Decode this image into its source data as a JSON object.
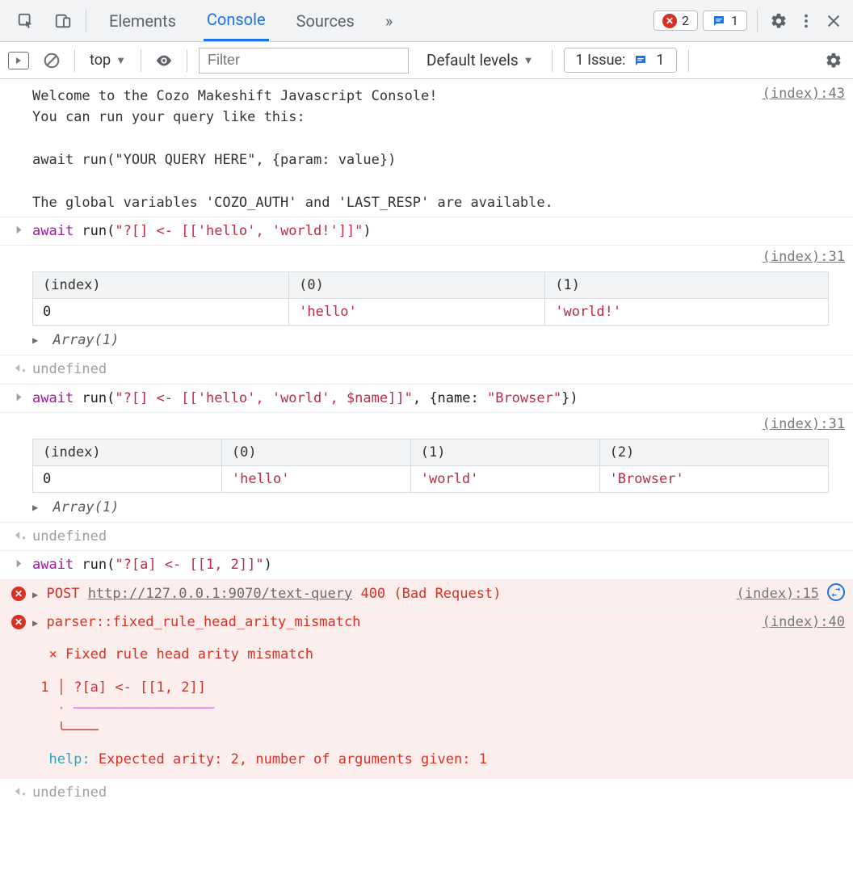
{
  "topbar": {
    "tabs": [
      "Elements",
      "Console",
      "Sources"
    ],
    "active_tab": 1,
    "more_symbol": "»",
    "error_count": "2",
    "info_count": "1"
  },
  "subbar": {
    "context": "top",
    "filter_placeholder": "Filter",
    "levels_label": "Default levels",
    "issues_label": "1 Issue:",
    "issues_count": "1"
  },
  "welcome": {
    "text": "Welcome to the Cozo Makeshift Javascript Console!\nYou can run your query like this:\n\nawait run(\"YOUR QUERY HERE\", {param: value})\n\nThe global variables 'COZO_AUTH' and 'LAST_RESP' are available.",
    "src": "(index):43"
  },
  "cmd1": {
    "await": "await",
    "fn": " run(",
    "arg": "\"?[] <- [['hello', 'world!']]\"",
    "tail": ")"
  },
  "res1": {
    "src": "(index):31",
    "headers": [
      "(index)",
      "(0)",
      "(1)"
    ],
    "rows": [
      {
        "idx": "0",
        "vals": [
          "'hello'",
          "'world!'"
        ]
      }
    ],
    "array_label": "Array(1)"
  },
  "undef_label": "undefined",
  "cmd2": {
    "await": "await",
    "fn": " run(",
    "arg": "\"?[] <- [['hello', 'world', $name]]\"",
    "mid": ", {name: ",
    "arg2": "\"Browser\"",
    "tail": "})"
  },
  "res2": {
    "src": "(index):31",
    "headers": [
      "(index)",
      "(0)",
      "(1)",
      "(2)"
    ],
    "rows": [
      {
        "idx": "0",
        "vals": [
          "'hello'",
          "'world'",
          "'Browser'"
        ]
      }
    ],
    "array_label": "Array(1)"
  },
  "cmd3": {
    "await": "await",
    "fn": " run(",
    "arg": "\"?[a] <- [[1, 2]]\"",
    "tail": ")"
  },
  "err_net": {
    "method": "POST",
    "url": "http://127.0.0.1:9070/text-query",
    "status": "400 (Bad Request)",
    "src": "(index):15"
  },
  "err_parse": {
    "title": "parser::fixed_rule_head_arity_mismatch",
    "src": "(index):40",
    "x_line": "  × Fixed rule head arity mismatch",
    "line_no": " 1 ",
    "line_code": " ?[a] <- [[1, 2]]",
    "help_key": "  help:",
    "help_text": " Expected arity: 2, number of arguments given: 1"
  }
}
